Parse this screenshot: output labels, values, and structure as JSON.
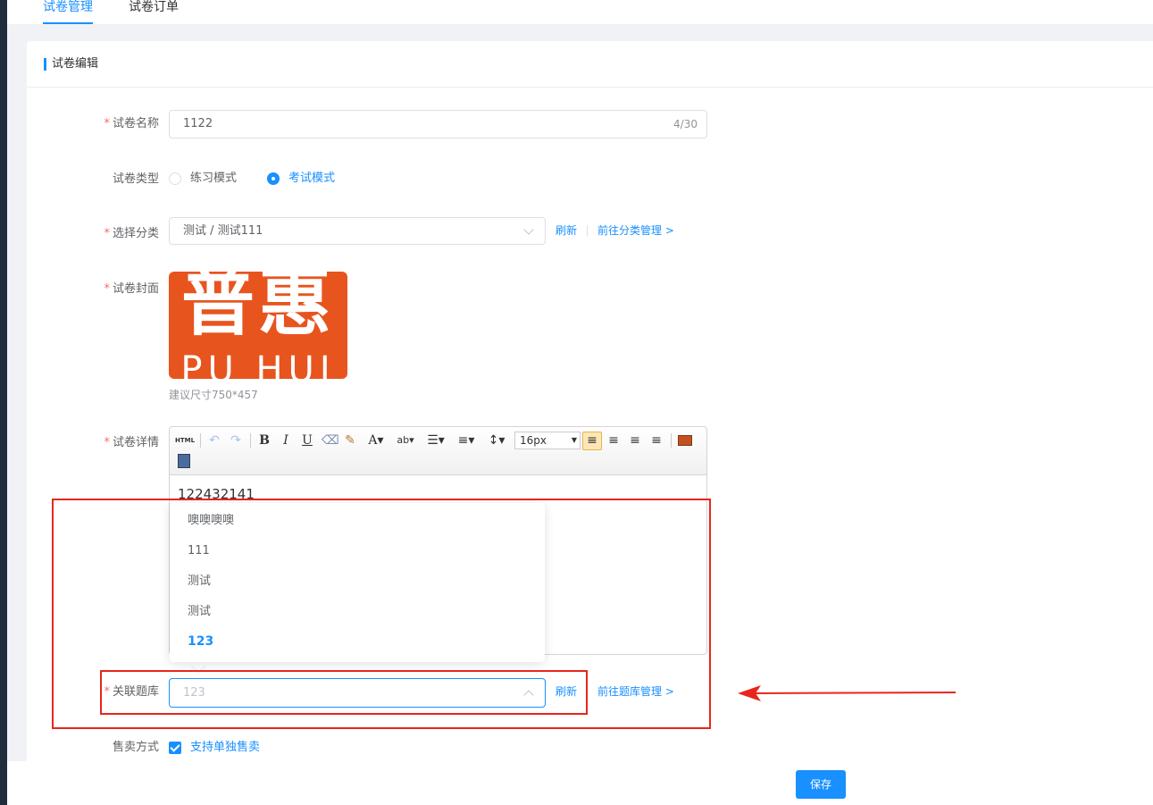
{
  "tabs": [
    {
      "label": "试卷管理",
      "active": true
    },
    {
      "label": "试卷订单",
      "active": false
    }
  ],
  "card": {
    "title": "试卷编辑"
  },
  "form": {
    "name": {
      "label": "试卷名称",
      "required": true,
      "value": "1122",
      "count": "4/30"
    },
    "type": {
      "label": "试卷类型",
      "options": [
        "练习模式",
        "考试模式"
      ],
      "selected": "考试模式"
    },
    "category": {
      "label": "选择分类",
      "required": true,
      "value": "测试 / 测试111",
      "refresh": "刷新",
      "manage": "前往分类管理 >"
    },
    "cover": {
      "label": "试卷封面",
      "required": true,
      "image_big": "普惠",
      "image_small": "PU HUI",
      "hint": "建议尺寸750*457"
    },
    "detail": {
      "label": "试卷详情",
      "required": true,
      "html_label": "HTML",
      "font_size": "16px",
      "content": "122432141"
    },
    "bank": {
      "label": "关联题库",
      "required": true,
      "placeholder": "123",
      "refresh": "刷新",
      "manage": "前往题库管理 >",
      "dropdown": [
        "噢噢噢噢",
        "111",
        "测试",
        "测试",
        "123"
      ],
      "selected_index": 4
    },
    "sale": {
      "label": "售卖方式",
      "checkbox_label": "支持单独售卖",
      "checked": true
    }
  },
  "save_label": "保存",
  "colors": {
    "primary": "#1890ff",
    "required": "#f56c6c",
    "annotation": "#e8261e",
    "cover_bg": "#e8541e"
  }
}
